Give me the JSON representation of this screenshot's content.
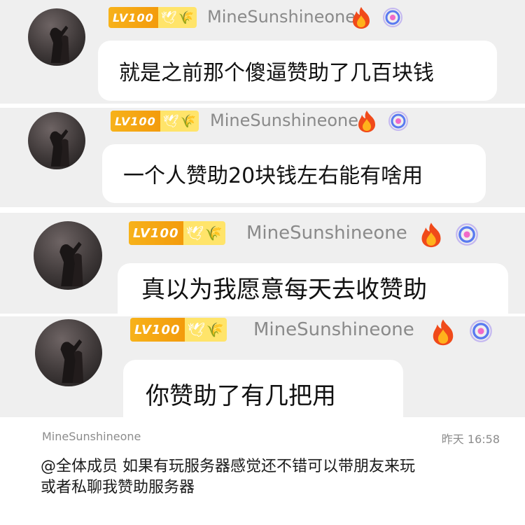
{
  "messages": [
    {
      "level": "LV100",
      "username": "MineSunshineone",
      "text": "就是之前那个傻逼赞助了几百块钱"
    },
    {
      "level": "LV100",
      "username": "MineSunshineone",
      "text": "一个人赞助20块钱左右能有啥用"
    },
    {
      "level": "LV100",
      "username": "MineSunshineone",
      "text": "真以为我愿意每天去收赞助"
    },
    {
      "level": "LV100",
      "username": "MineSunshineone",
      "text": "你赞助了有几把用"
    }
  ],
  "announcement": {
    "username": "MineSunshineone",
    "time": "昨天 16:58",
    "line1": "@全体成员 如果有玩服务器感觉还不错可以带朋友来玩",
    "line2": "或者私聊我赞助服务器"
  },
  "colors": {
    "strip_bg": "#efefef",
    "badge_gold": "#f7b21a",
    "badge_light": "#ffe46a",
    "name_gray": "#8a8a8a"
  },
  "icons": [
    "avatar",
    "dove-icon",
    "wheat-icon",
    "fire-icon",
    "swirl-icon"
  ]
}
